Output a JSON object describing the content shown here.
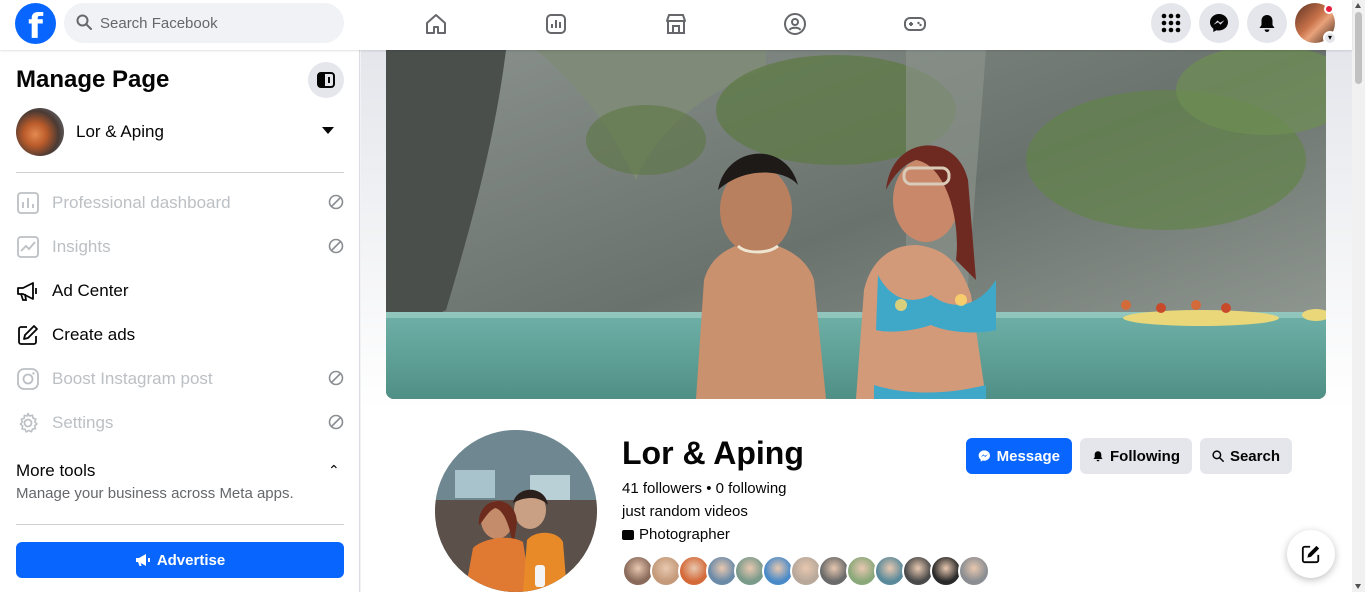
{
  "header": {
    "logo_letter": "f",
    "search": {
      "placeholder": "Search Facebook",
      "value": ""
    },
    "nav_icons": [
      "home-icon",
      "professional-dashboard-icon",
      "marketplace-icon",
      "groups-icon",
      "gaming-icon"
    ],
    "right_icons": [
      "menu-grid-icon",
      "messenger-icon",
      "notifications-bell-icon"
    ],
    "notification_dot_color": "#e41e3f",
    "brand_color": "#0866ff"
  },
  "sidebar": {
    "title": "Manage Page",
    "page_name": "Lor & Aping",
    "items": [
      {
        "label": "Professional dashboard",
        "icon": "dashboard-icon",
        "disabled": true
      },
      {
        "label": "Insights",
        "icon": "insights-icon",
        "disabled": true
      },
      {
        "label": "Ad Center",
        "icon": "megaphone-icon",
        "disabled": false
      },
      {
        "label": "Create ads",
        "icon": "pencil-square-icon",
        "disabled": false
      },
      {
        "label": "Boost Instagram post",
        "icon": "instagram-icon",
        "disabled": true
      },
      {
        "label": "Settings",
        "icon": "gear-icon",
        "disabled": true
      }
    ],
    "more_tools": {
      "title": "More tools",
      "subtitle": "Manage your business across Meta apps."
    },
    "advertise_label": "Advertise"
  },
  "profile": {
    "name": "Lor & Aping",
    "stats": "41 followers • 0 following",
    "bio": "just random videos",
    "category": "Photographer",
    "buttons": {
      "message": "Message",
      "following": "Following",
      "search": "Search"
    },
    "follower_avatar_colors": [
      "#8a6a5a",
      "#c49a7a",
      "#d46a3a",
      "#6a8aa8",
      "#7a9a8a",
      "#4a8ac8",
      "#b8a89a",
      "#6a6a6a",
      "#8aa87a",
      "#5a8a9a",
      "#4a4a4a",
      "#2a2a2a",
      "#8a8d91"
    ]
  }
}
